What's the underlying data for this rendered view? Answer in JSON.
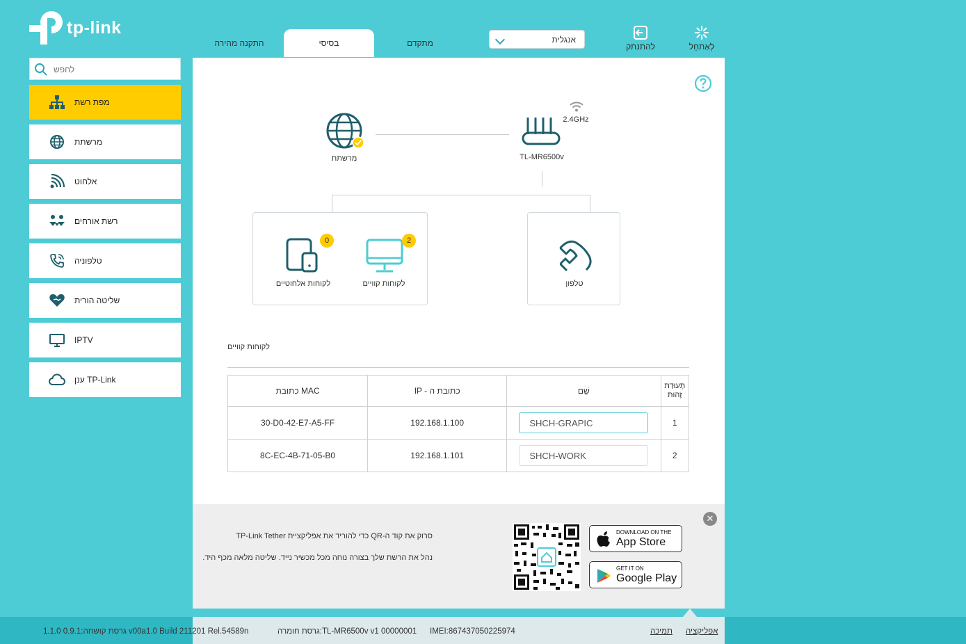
{
  "brand": {
    "name": "tp-link",
    "accent": "#4dccd6",
    "highlight": "#ffcc00",
    "dark_icon": "#1f5f6b"
  },
  "top_tabs": [
    {
      "label": "התקנה מהירה"
    },
    {
      "label": "בסיסי"
    },
    {
      "label": "מתקדם"
    }
  ],
  "language": {
    "selected": "אנגלית"
  },
  "top_buttons": {
    "logout": "להתנתק",
    "reboot": "לְאַתחֵל"
  },
  "sidebar": {
    "search_placeholder": "לחפש",
    "items": [
      {
        "label": "מפת רשת",
        "icon": "network-map-icon"
      },
      {
        "label": "מרשתת",
        "icon": "globe-icon"
      },
      {
        "label": "אלחוט",
        "icon": "wireless-icon"
      },
      {
        "label": "רשת אורחים",
        "icon": "guests-icon"
      },
      {
        "label": "טלפוניה",
        "icon": "phone-icon"
      },
      {
        "label": "שליטה הורית",
        "icon": "heart-icon"
      },
      {
        "label": "IPTV",
        "icon": "monitor-icon"
      },
      {
        "label": "TP-Link ענן",
        "icon": "cloud-icon"
      }
    ]
  },
  "network_map": {
    "internet_label": "מרשתת",
    "router_label": "TL-MR6500v",
    "band_label": "2.4GHz",
    "wired_clients": {
      "label": "לקוחות קוויים",
      "count": "2"
    },
    "wireless_clients": {
      "label": "לקוחות אלחוטיים",
      "count": "0"
    },
    "phone": {
      "label": "טלפון"
    }
  },
  "clients_section": {
    "title": "לקוחות קוויים",
    "headers": {
      "mac": "כתובת MAC",
      "ip": "IP - כתובת ה",
      "name": "שֵׁם",
      "id_line1": "תְעוּדַת",
      "id_line2": "זֶהוּת"
    },
    "rows": [
      {
        "mac": "30-D0-42-E7-A5-FF",
        "ip": "192.168.1.100",
        "name": "SHCH-GRAPIC",
        "id": "1"
      },
      {
        "mac": "8C-EC-4B-71-05-B0",
        "ip": "192.168.1.101",
        "name": "SHCH-WORK",
        "id": "2"
      }
    ]
  },
  "promo": {
    "line1": "סרוק את קוד ה-QR כדי להוריד את אפליקציית TP-Link Tether",
    "line2": "נהל את הרשת שלך בצורה נוחה מכל מכשיר נייד. שליטה מלאה מכף היד.",
    "app_store": {
      "small": "DOWNLOAD ON THE",
      "big": "App Store"
    },
    "google_play": {
      "small": "GET IT ON",
      "big": "Google Play"
    }
  },
  "footer": {
    "firmware": "גרסת קושחה:0.9.1 1.1.0 v00a1.0 Build 211201 Rel.54589n",
    "hardware": "גרסת חומרה:TL-MR6500v v1 00000001",
    "imei": "IMEI:867437050225974",
    "support": "תמיכה",
    "app": "אפליקציה"
  }
}
